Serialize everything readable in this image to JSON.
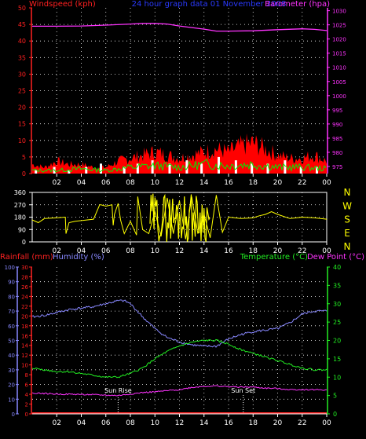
{
  "title": "24 hour graph data  01 November 2008",
  "colors": {
    "wind_axis": "#ff2020",
    "baro": "#ff33ff",
    "title": "#2a3aff",
    "wind_fill": "#ff0000",
    "gust_fill": "#ffffff",
    "avg_wind": "#00ee00",
    "direction": "#ffff00",
    "humidity": "#8888ff",
    "temperature": "#22ee22",
    "dewpoint": "#ff33ff",
    "rainfall": "#ff2222",
    "grid": "#ffffff",
    "axis": "#ffffff"
  },
  "chart_data": [
    {
      "id": "wind_pressure",
      "type": "area",
      "title": "24 hour graph data  01 November 2008",
      "ylabel_left": "Windspeed (kph)",
      "ylabel_right": "Barometer (hpa)",
      "y_left_ticks": [
        "0",
        "5",
        "10",
        "15",
        "20",
        "25",
        "30",
        "35",
        "40",
        "45",
        "50"
      ],
      "y_left_range": [
        0,
        50
      ],
      "y_right_ticks": [
        "975",
        "980",
        "985",
        "990",
        "995",
        "1000",
        "1005",
        "1010",
        "1015",
        "1020",
        "1025",
        "1030"
      ],
      "y_right_range": [
        972.5,
        1031
      ],
      "x_ticks": [
        "02",
        "04",
        "06",
        "08",
        "10",
        "12",
        "14",
        "16",
        "18",
        "20",
        "22",
        "00"
      ],
      "x_range_hours": [
        0,
        24
      ],
      "series": [
        {
          "key": "barometer",
          "axis": "right",
          "x": [
            0,
            2,
            4,
            6,
            8,
            9,
            10,
            11,
            12,
            14,
            15,
            16,
            18,
            20,
            22,
            23,
            24
          ],
          "values": [
            1024.5,
            1024.5,
            1024.6,
            1024.9,
            1025.3,
            1025.5,
            1025.5,
            1025.3,
            1024.6,
            1023.5,
            1022.8,
            1022.8,
            1022.9,
            1023.3,
            1023.6,
            1023.4,
            1023.0
          ]
        },
        {
          "key": "windspeed_max",
          "axis": "left",
          "x": [
            0,
            1,
            2,
            3,
            4,
            5,
            6,
            7,
            8,
            9,
            10,
            11,
            12,
            13,
            14,
            15,
            16,
            17,
            18,
            19,
            20,
            21,
            22,
            23,
            24
          ],
          "values": [
            3,
            2,
            4,
            3,
            3,
            2,
            2,
            4,
            5,
            6,
            7,
            6,
            5,
            6,
            7,
            8,
            7,
            9,
            10,
            8,
            6,
            5,
            5,
            6,
            4
          ]
        },
        {
          "key": "gust_spikes",
          "axis": "left",
          "x": [
            0.3,
            1.8,
            3.0,
            4.4,
            5.6,
            7.5,
            8.6,
            9.8,
            11.2,
            12.6,
            13.8,
            15.2,
            16.6,
            17.9,
            19.2,
            20.6,
            21.9,
            23.2
          ],
          "values": [
            1,
            2,
            1,
            2,
            3,
            2,
            3,
            4,
            3,
            4,
            3,
            5,
            4,
            3,
            3,
            4,
            2,
            2
          ]
        },
        {
          "key": "wind_avg",
          "axis": "left",
          "x": [
            0,
            2,
            4,
            6,
            8,
            10,
            12,
            14,
            16,
            18,
            20,
            22,
            24
          ],
          "values": [
            1,
            1,
            1.5,
            1,
            2,
            2.5,
            2,
            3,
            2.5,
            3,
            2,
            2,
            1.5
          ]
        }
      ]
    },
    {
      "id": "wind_direction",
      "type": "line",
      "y_left_ticks": [
        "0",
        "90",
        "180",
        "270",
        "360"
      ],
      "y_left_range": [
        0,
        360
      ],
      "y_right_ticks": [
        "N",
        "W",
        "S",
        "E",
        "N"
      ],
      "x_ticks": [
        "02",
        "04",
        "06",
        "08",
        "10",
        "12",
        "14",
        "16",
        "18",
        "20",
        "22",
        "00"
      ],
      "series": [
        {
          "key": "direction",
          "x": [
            0,
            0.5,
            1,
            2,
            2.7,
            2.75,
            3,
            3.5,
            4,
            5,
            5.5,
            5.6,
            6,
            6.5,
            6.6,
            6.7,
            7,
            7.2,
            7.5,
            8,
            8.5,
            8.6,
            9,
            9.5,
            10,
            10.5,
            11,
            11.5,
            12,
            12.5,
            13,
            13.5,
            14,
            14.5,
            15,
            15.5,
            16,
            17,
            18,
            18.5,
            19,
            19.5,
            20,
            21,
            22,
            23,
            24
          ],
          "values": [
            160,
            140,
            170,
            175,
            180,
            60,
            140,
            150,
            155,
            165,
            270,
            270,
            260,
            270,
            120,
            200,
            280,
            160,
            60,
            150,
            50,
            330,
            90,
            60,
            220,
            40,
            320,
            60,
            300,
            20,
            330,
            60,
            200,
            30,
            340,
            70,
            180,
            170,
            175,
            190,
            200,
            220,
            200,
            170,
            180,
            175,
            165
          ]
        }
      ]
    },
    {
      "id": "temperature_humidity",
      "type": "line",
      "ylabel_left_1": "Rainfall (mm)",
      "ylabel_left_2": "Humidity (%)",
      "ylabel_right_1": "Temperature (°C)",
      "ylabel_right_2": "Dew Point (°C)",
      "humidity_ticks": [
        "0",
        "10",
        "20",
        "30",
        "40",
        "50",
        "60",
        "70",
        "80",
        "90",
        "100"
      ],
      "rain_ticks": [
        "0",
        "2",
        "4",
        "6",
        "8",
        "10",
        "12",
        "14",
        "16",
        "18",
        "20",
        "22",
        "24",
        "26",
        "28",
        "30"
      ],
      "temp_ticks": [
        "0",
        "5",
        "10",
        "15",
        "20",
        "25",
        "30",
        "35",
        "40"
      ],
      "x_ticks": [
        "02",
        "04",
        "06",
        "08",
        "10",
        "12",
        "14",
        "16",
        "18",
        "20",
        "22",
        "00"
      ],
      "annotations": [
        "Sun Rise",
        "Sun Set"
      ],
      "annotation_x_hours": [
        7.0,
        17.2
      ],
      "series": [
        {
          "key": "humidity",
          "axis": "humidity",
          "x": [
            0,
            1,
            2,
            3,
            4,
            5,
            6,
            7,
            7.5,
            8,
            9,
            10,
            11,
            12,
            13,
            14,
            15,
            16,
            17,
            18,
            19,
            20,
            21,
            22,
            23,
            24
          ],
          "values": [
            66,
            67,
            69,
            71,
            72,
            73,
            75,
            77,
            77,
            75,
            66,
            58,
            52,
            49,
            47,
            46,
            46,
            51,
            54,
            56,
            57,
            58,
            62,
            68,
            70,
            70
          ]
        },
        {
          "key": "temperature",
          "axis": "temp",
          "x": [
            0,
            1,
            2,
            3,
            4,
            5,
            6,
            7,
            8,
            9,
            10,
            11,
            12,
            13,
            14,
            15,
            16,
            17,
            18,
            19,
            20,
            21,
            22,
            23,
            24
          ],
          "values": [
            12.5,
            12,
            11.5,
            11.5,
            11,
            10.5,
            10,
            10,
            11,
            12.5,
            15,
            17,
            18.5,
            19.5,
            20,
            20,
            19,
            17.5,
            16.5,
            15.5,
            14.5,
            13.5,
            12.5,
            12,
            12
          ]
        },
        {
          "key": "dewpoint",
          "axis": "temp",
          "x": [
            0,
            2,
            4,
            6,
            7,
            8,
            9,
            10,
            11,
            12,
            13,
            14,
            15,
            16,
            17,
            18,
            19,
            20,
            21,
            22,
            23,
            24
          ],
          "values": [
            5.7,
            5.4,
            5.3,
            5.1,
            5.0,
            5.4,
            5.8,
            6.0,
            6.3,
            6.6,
            7.2,
            7.5,
            7.6,
            7.4,
            7.3,
            7.3,
            7.0,
            6.9,
            6.6,
            6.6,
            6.6,
            6.5
          ]
        },
        {
          "key": "rainfall",
          "axis": "rain",
          "x": [
            0,
            24
          ],
          "values": [
            0,
            0
          ]
        }
      ]
    }
  ]
}
